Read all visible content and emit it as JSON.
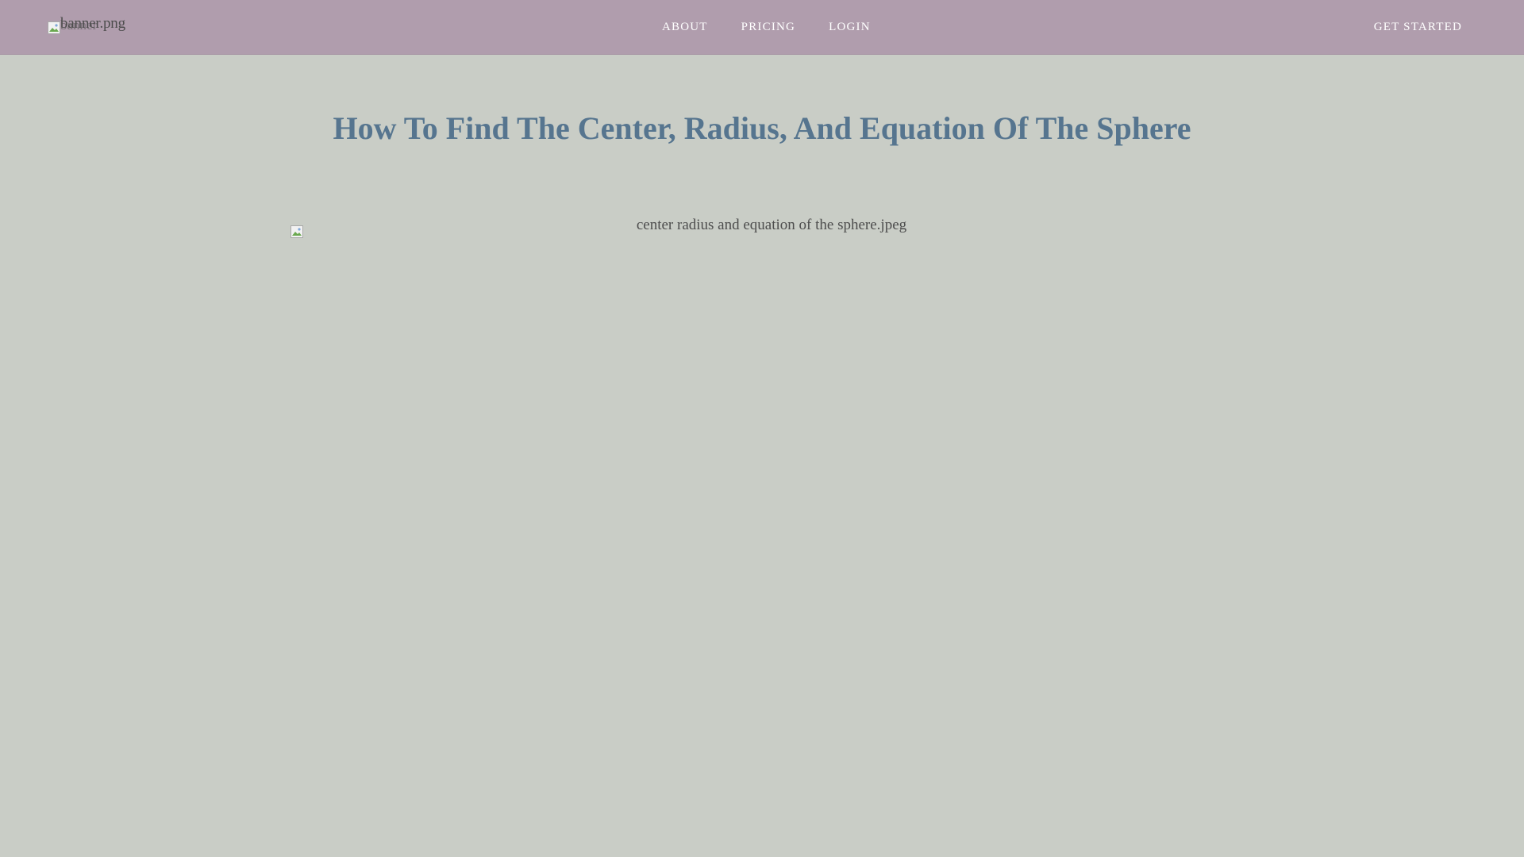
{
  "header": {
    "logo_alt": "banner.png",
    "logo_alt_overlay": "banner",
    "nav_links": [
      {
        "label": "ABOUT"
      },
      {
        "label": "PRICING"
      },
      {
        "label": "LOGIN"
      }
    ],
    "cta_label": "GET STARTED"
  },
  "main": {
    "title": "How To Find The Center, Radius, And Equation Of The Sphere",
    "hero_image_alt": "center radius and equation of the sphere.jpeg"
  },
  "colors": {
    "page_background": "#c9cdc6",
    "navbar_background": "#b09dad",
    "title_color": "#56758f",
    "nav_text": "#ffffff"
  },
  "icons": {
    "logo": "broken-image-icon",
    "hero": "broken-image-icon"
  }
}
